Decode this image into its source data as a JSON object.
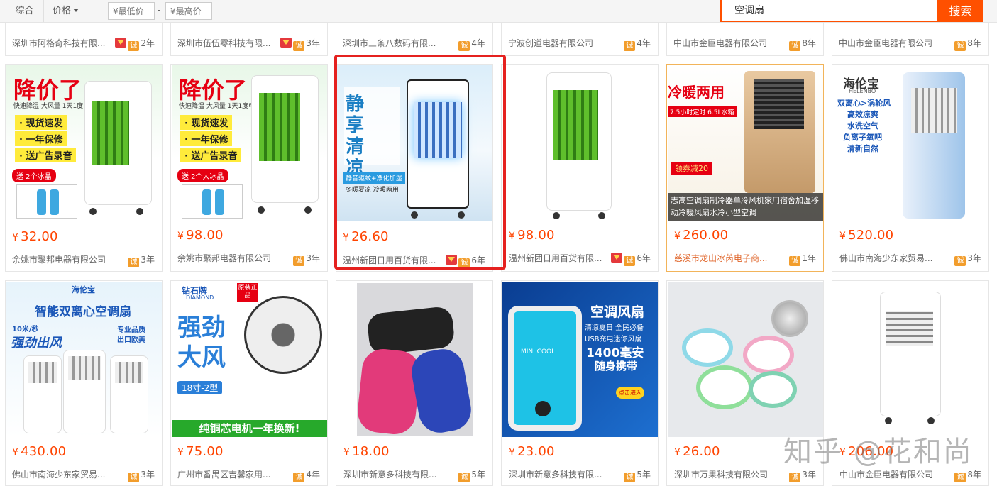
{
  "toolbar": {
    "sort_tabs": [
      "综合",
      "价格"
    ],
    "min_price_placeholder": "¥最低价",
    "max_price_placeholder": "¥最高价",
    "price_dash": "-"
  },
  "search": {
    "value": "空调扇",
    "button": "搜索"
  },
  "colors": {
    "accent": "#ff5000",
    "price": "#ff4400",
    "highlight_frame": "#e5211f"
  },
  "top_strip": [
    {
      "shop": "深圳市阿格奇科技有限...",
      "years": "2年",
      "crown": true
    },
    {
      "shop": "深圳市伍伍零科技有限...",
      "years": "3年",
      "crown": true
    },
    {
      "shop": "深圳市三条八数码有限...",
      "years": "4年",
      "crown": false
    },
    {
      "shop": "宁波创道电器有限公司",
      "years": "4年",
      "crown": false
    },
    {
      "shop": "中山市金臣电器有限公司",
      "years": "8年",
      "crown": false
    },
    {
      "shop": "中山市金臣电器有限公司",
      "years": "8年",
      "crown": false
    }
  ],
  "products_row1": [
    {
      "price": "32.00",
      "shop": "余姚市聚邦电器有限公司",
      "years": "3年",
      "crown": false,
      "img": {
        "promo": "降价了",
        "sub": "快速降温 大风量 1天1度电",
        "lines": [
          "· 现货速发",
          "· 一年保修",
          "· 送广告录音"
        ],
        "gift": "送 2个冰晶"
      }
    },
    {
      "price": "98.00",
      "shop": "余姚市聚邦电器有限公司",
      "years": "3年",
      "crown": false,
      "img": {
        "promo": "降价了",
        "sub": "快速降温 大风量 1天1度电",
        "lines": [
          "· 现货速发",
          "· 一年保修",
          "· 送广告录音"
        ],
        "gift": "送 2个大冰晶"
      }
    },
    {
      "price": "26.60",
      "shop": "温州新团日用百货有限...",
      "years": "6年",
      "crown": true,
      "img": {
        "big": "静享清凉",
        "tag": "静音驱蚊+净化加湿",
        "sub": "冬暖夏凉 冷暖两用"
      }
    },
    {
      "price": "98.00",
      "shop": "温州新团日用百货有限...",
      "years": "6年",
      "crown": true,
      "img": {}
    },
    {
      "price": "260.00",
      "shop": "慈溪市龙山冰芮电子商...",
      "years": "1年",
      "crown": false,
      "img": {
        "head": "冷暖两用",
        "sub": "7.5小时定时 6.5L水箱",
        "coupon": "领券减20",
        "caption": "志高空调扇制冷器单冷风机家用宿舍加湿移动冷暖风扇水冷小型空调"
      }
    },
    {
      "price": "520.00",
      "shop": "佛山市南海少东家贸易...",
      "years": "3年",
      "crown": false,
      "img": {
        "brand": "海伦宝",
        "brand_en": "HELENBO",
        "lines": [
          "双离心>涡轮风",
          "高效凉爽",
          "水洗空气",
          "负离子氧吧",
          "清新自然"
        ]
      }
    }
  ],
  "products_row2": [
    {
      "price": "430.00",
      "shop": "佛山市南海少东家贸易...",
      "years": "3年",
      "img": {
        "brand": "海伦宝",
        "title": "智能双离心空调扇",
        "speed": "10米/秒",
        "strong": "强劲出风",
        "tags": [
          "专业品质",
          "出口欧美"
        ]
      }
    },
    {
      "price": "75.00",
      "shop": "广州市番禺区吉馨家用...",
      "years": "4年",
      "img": {
        "brand": "钻石牌",
        "brand_en": "DIAMOND",
        "stamp": "原装正品",
        "big": "强劲大风",
        "size": "18寸-2型",
        "foot": "纯铜芯电机一年换新!"
      }
    },
    {
      "price": "18.00",
      "shop": "深圳市新意多科技有限...",
      "years": "5年",
      "img": {}
    },
    {
      "price": "23.00",
      "shop": "深圳市新意多科技有限...",
      "years": "5年",
      "img": {
        "title": "空调风扇",
        "lines": [
          "清凉夏日 全民必备",
          "USB充电迷你风扇",
          "1400毫安",
          "随身携带"
        ],
        "device": "MINI COOL",
        "btn": "点击进入"
      }
    },
    {
      "price": "26.00",
      "shop": "深圳市万果科技有限公司",
      "years": "3年",
      "img": {}
    },
    {
      "price": "206.00",
      "shop": "中山市金臣电器有限公司",
      "years": "8年",
      "img": {}
    }
  ],
  "watermark": "知乎 @花和尚"
}
